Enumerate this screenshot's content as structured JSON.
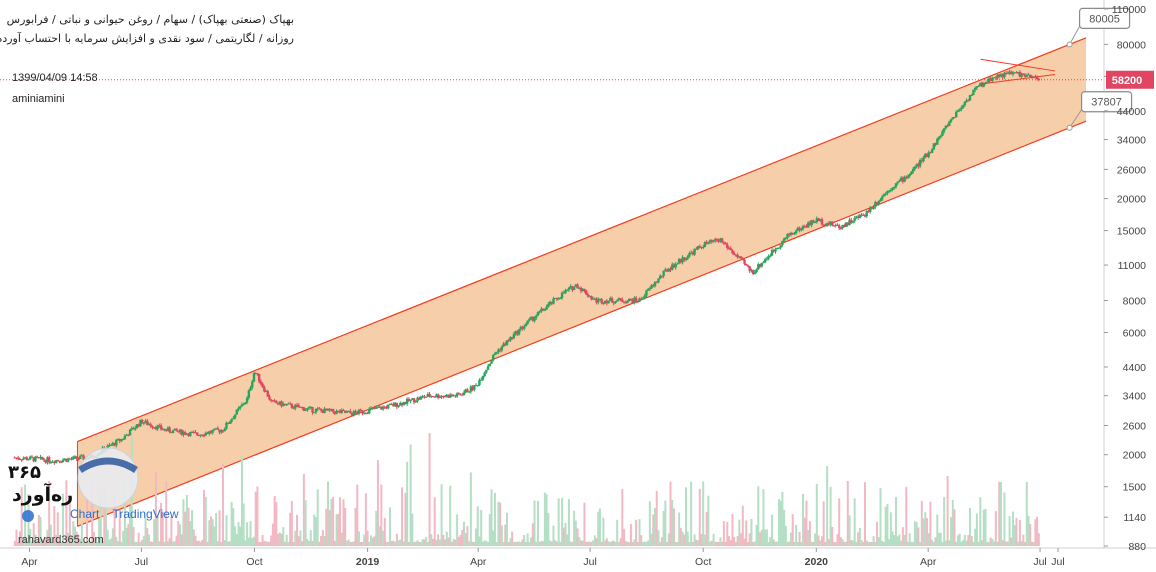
{
  "header": {
    "line1": "بهپاک (صنعتی بهپاک) / سهام / روغن حیوانی و نباتی / فرابورس",
    "line2": "روزانه / لگاریتمی / سود نقدی و افزایش سرمایه با احتساب آورده"
  },
  "cursor_datetime": "1399/04/09 14:58",
  "author": "aminiamini",
  "watermark": {
    "number": "۳۶۵",
    "brand": "ره‌آورد",
    "site": "rahavard365.com",
    "tv": "TradingView",
    "tv_chart": "Chart"
  },
  "colors": {
    "channel_fill": "#f5c9a0",
    "channel_line": "#f23c1f",
    "up": "#26a65b",
    "down": "#e04561",
    "vol_up": "#b5dfc5",
    "vol_down": "#f2b9c4",
    "price_tag": "#e04561",
    "axis_text": "#444444"
  },
  "chart_data": {
    "type": "candlestick",
    "scale": "log",
    "ylim": [
      880,
      115000
    ],
    "price_ticks": [
      880,
      1140,
      1500,
      2000,
      2600,
      3400,
      4400,
      6000,
      8000,
      11000,
      15000,
      20000,
      26000,
      34000,
      44000,
      60000,
      80000,
      110000
    ],
    "time_ticks": [
      "Apr",
      "Jul",
      "Oct",
      "2019",
      "Apr",
      "Jul",
      "Oct",
      "2020",
      "Apr",
      "Jul",
      "Jul"
    ],
    "time_ticks_bold": [
      false,
      false,
      false,
      true,
      false,
      false,
      false,
      true,
      false,
      false,
      false
    ],
    "last_price": 58200,
    "last_price_label": "58200",
    "channel": {
      "upper": [
        {
          "date": "2018-05-10",
          "price": 2250
        },
        {
          "date": "2020-07-25",
          "price": 80005
        }
      ],
      "lower": [
        {
          "date": "2018-05-10",
          "price": 1050
        },
        {
          "date": "2020-07-25",
          "price": 37807
        }
      ],
      "upper_label": "80005",
      "lower_label": "37807"
    },
    "price_path": [
      {
        "date": "2018-03-20",
        "price": 1950
      },
      {
        "date": "2018-04-20",
        "price": 1900
      },
      {
        "date": "2018-05-20",
        "price": 1950
      },
      {
        "date": "2018-06-15",
        "price": 2300
      },
      {
        "date": "2018-07-01",
        "price": 2700
      },
      {
        "date": "2018-07-20",
        "price": 2500
      },
      {
        "date": "2018-08-15",
        "price": 2400
      },
      {
        "date": "2018-09-05",
        "price": 2500
      },
      {
        "date": "2018-09-25",
        "price": 3300
      },
      {
        "date": "2018-10-01",
        "price": 4250
      },
      {
        "date": "2018-10-15",
        "price": 3200
      },
      {
        "date": "2018-11-15",
        "price": 3000
      },
      {
        "date": "2018-12-20",
        "price": 2900
      },
      {
        "date": "2019-01-20",
        "price": 3100
      },
      {
        "date": "2019-02-20",
        "price": 3400
      },
      {
        "date": "2019-03-15",
        "price": 3400
      },
      {
        "date": "2019-03-30",
        "price": 3700
      },
      {
        "date": "2019-04-15",
        "price": 5000
      },
      {
        "date": "2019-05-10",
        "price": 6500
      },
      {
        "date": "2019-06-10",
        "price": 8600
      },
      {
        "date": "2019-06-20",
        "price": 9200
      },
      {
        "date": "2019-07-05",
        "price": 8000
      },
      {
        "date": "2019-08-10",
        "price": 8000
      },
      {
        "date": "2019-09-01",
        "price": 10500
      },
      {
        "date": "2019-10-01",
        "price": 13200
      },
      {
        "date": "2019-10-15",
        "price": 13800
      },
      {
        "date": "2019-11-10",
        "price": 10300
      },
      {
        "date": "2019-12-10",
        "price": 14500
      },
      {
        "date": "2020-01-01",
        "price": 16500
      },
      {
        "date": "2020-01-20",
        "price": 15500
      },
      {
        "date": "2020-02-10",
        "price": 17500
      },
      {
        "date": "2020-03-01",
        "price": 22000
      },
      {
        "date": "2020-03-15",
        "price": 24500
      },
      {
        "date": "2020-04-01",
        "price": 30000
      },
      {
        "date": "2020-04-20",
        "price": 41000
      },
      {
        "date": "2020-05-10",
        "price": 54000
      },
      {
        "date": "2020-05-25",
        "price": 60000
      },
      {
        "date": "2020-06-10",
        "price": 62000
      },
      {
        "date": "2020-06-30",
        "price": 58200
      }
    ]
  }
}
